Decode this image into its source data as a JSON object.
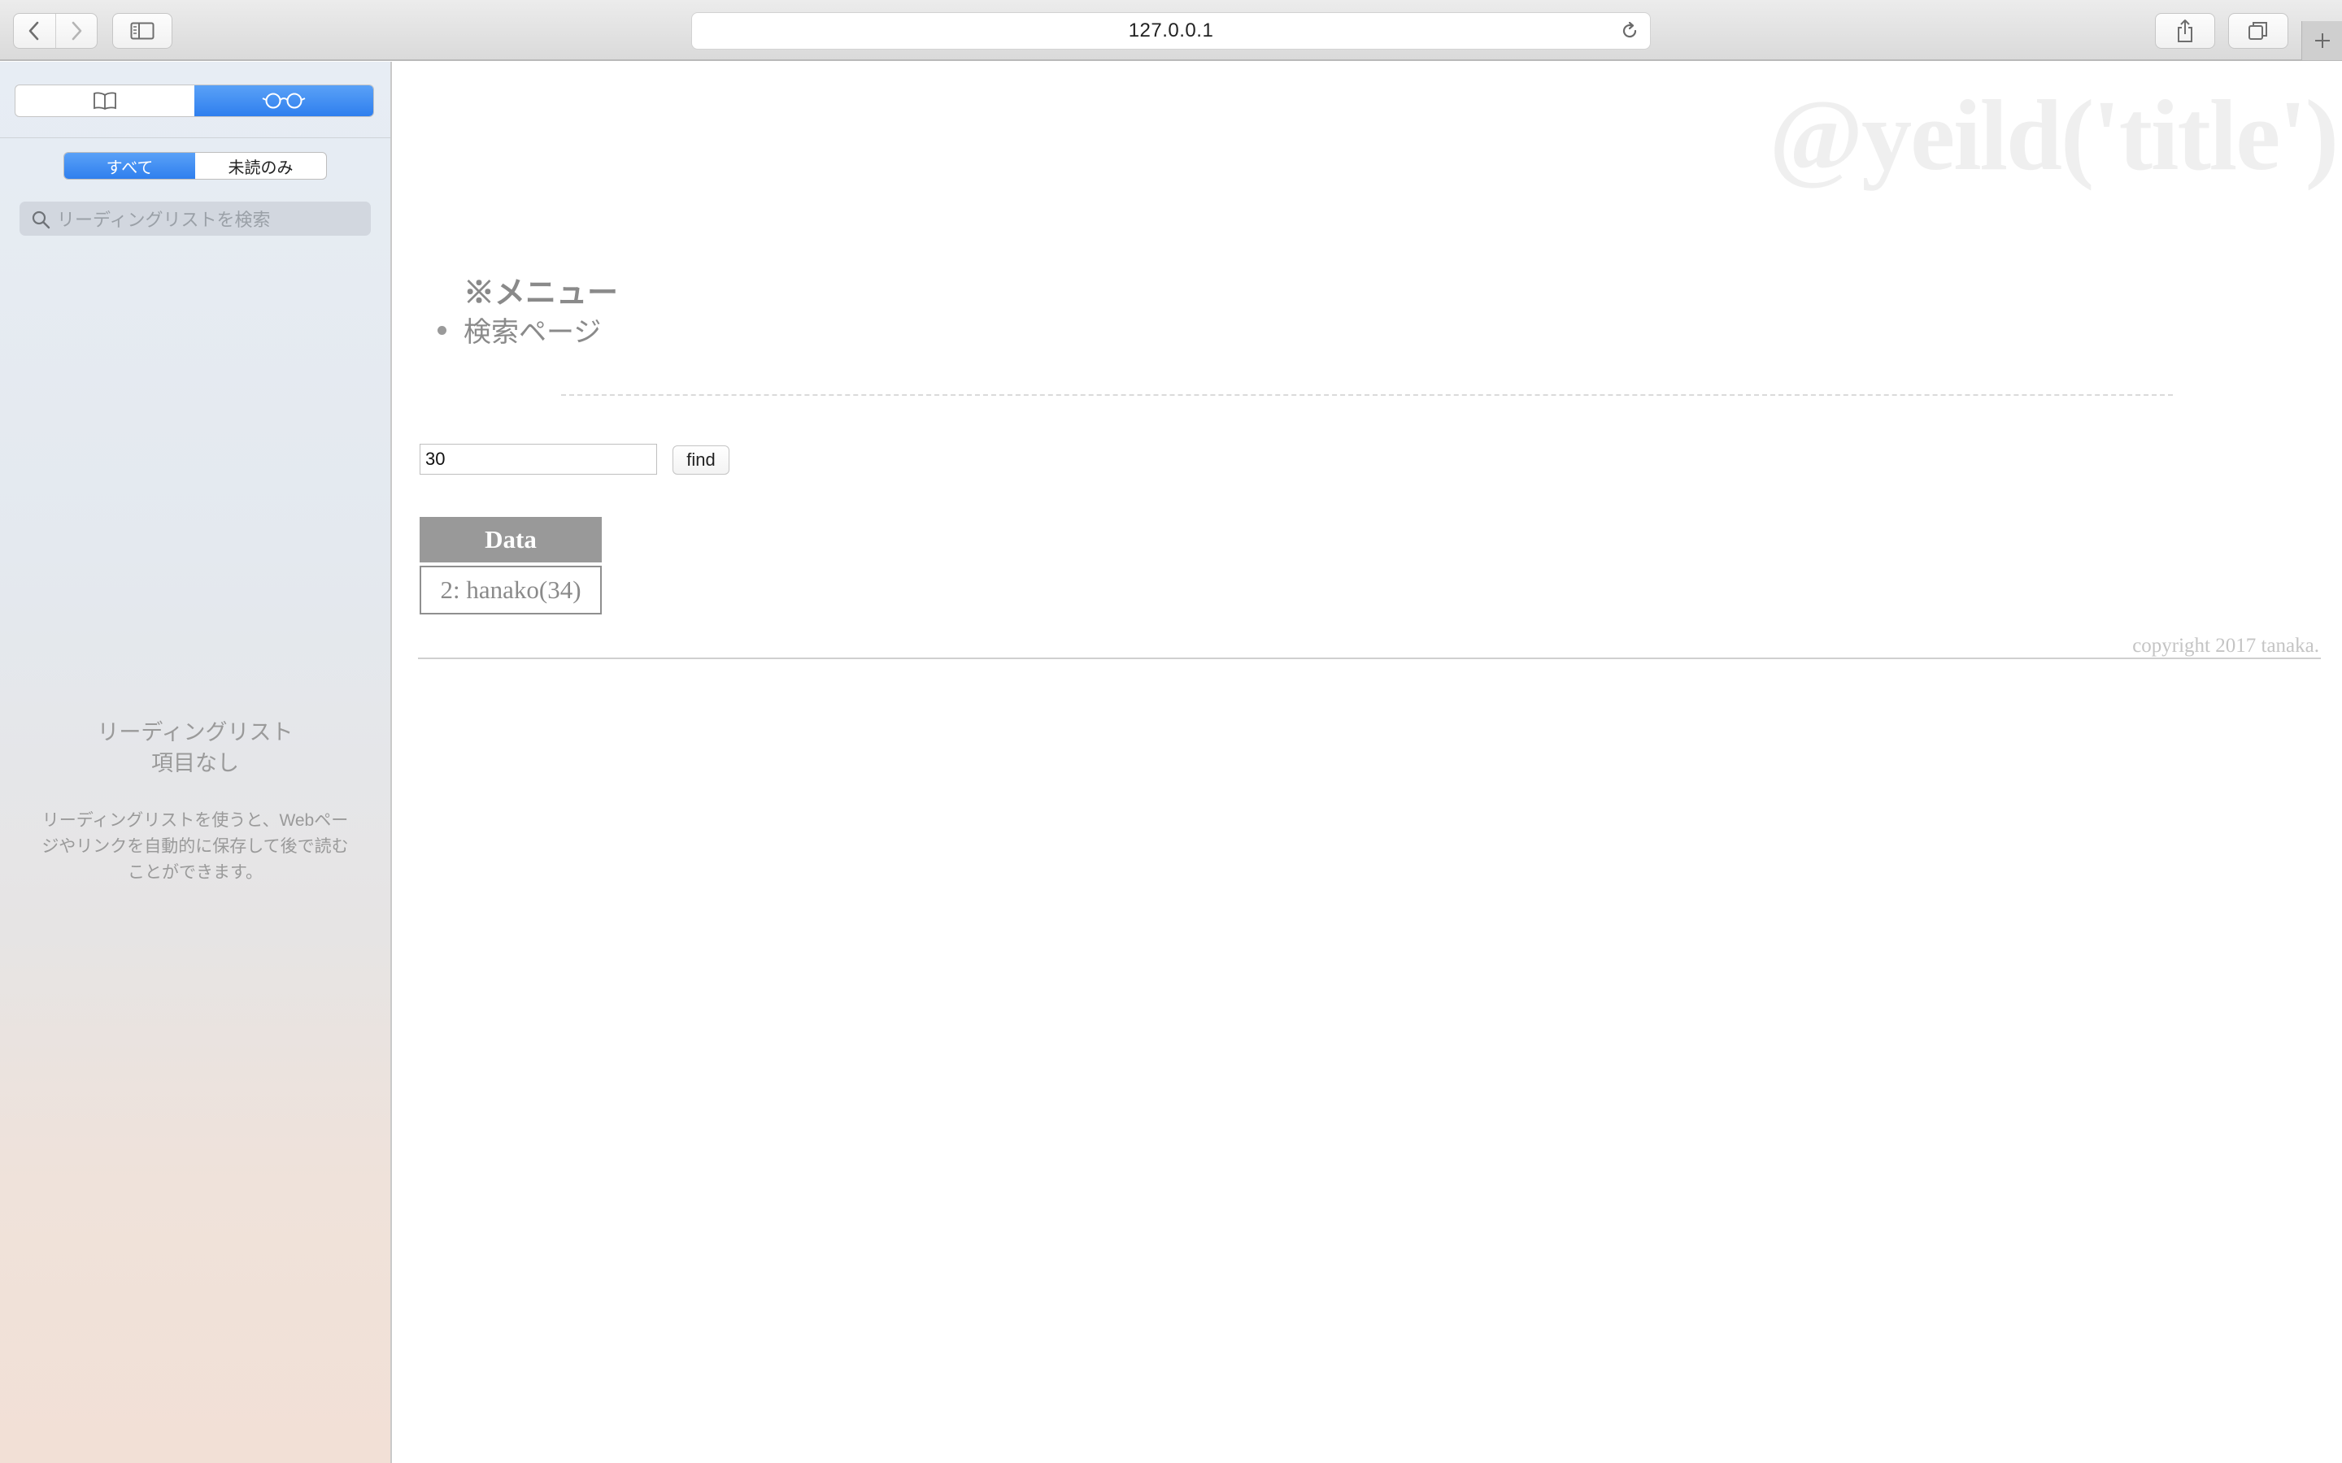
{
  "browser": {
    "url": "127.0.0.1"
  },
  "sidebar": {
    "filter": {
      "all_label": "すべて",
      "unread_label": "未読のみ"
    },
    "search_placeholder": "リーディングリストを検索",
    "empty_title_line1": "リーディングリスト",
    "empty_title_line2": "項目なし",
    "empty_description": "リーディングリストを使うと、Webページやリンクを自動的に保存して後で読むことができます。"
  },
  "page": {
    "watermark_title": "@yeild('title')",
    "menu_heading": "※メニュー",
    "menu_items": [
      "検索ページ"
    ],
    "search_value": "30",
    "find_label": "find",
    "table": {
      "header": "Data",
      "rows": [
        "2: hanako(34)"
      ]
    },
    "copyright": "copyright 2017 tanaka."
  },
  "colors": {
    "accent_blue": "#2f7fee",
    "table_header": "#999999",
    "text_gray": "#8a8a8a"
  }
}
